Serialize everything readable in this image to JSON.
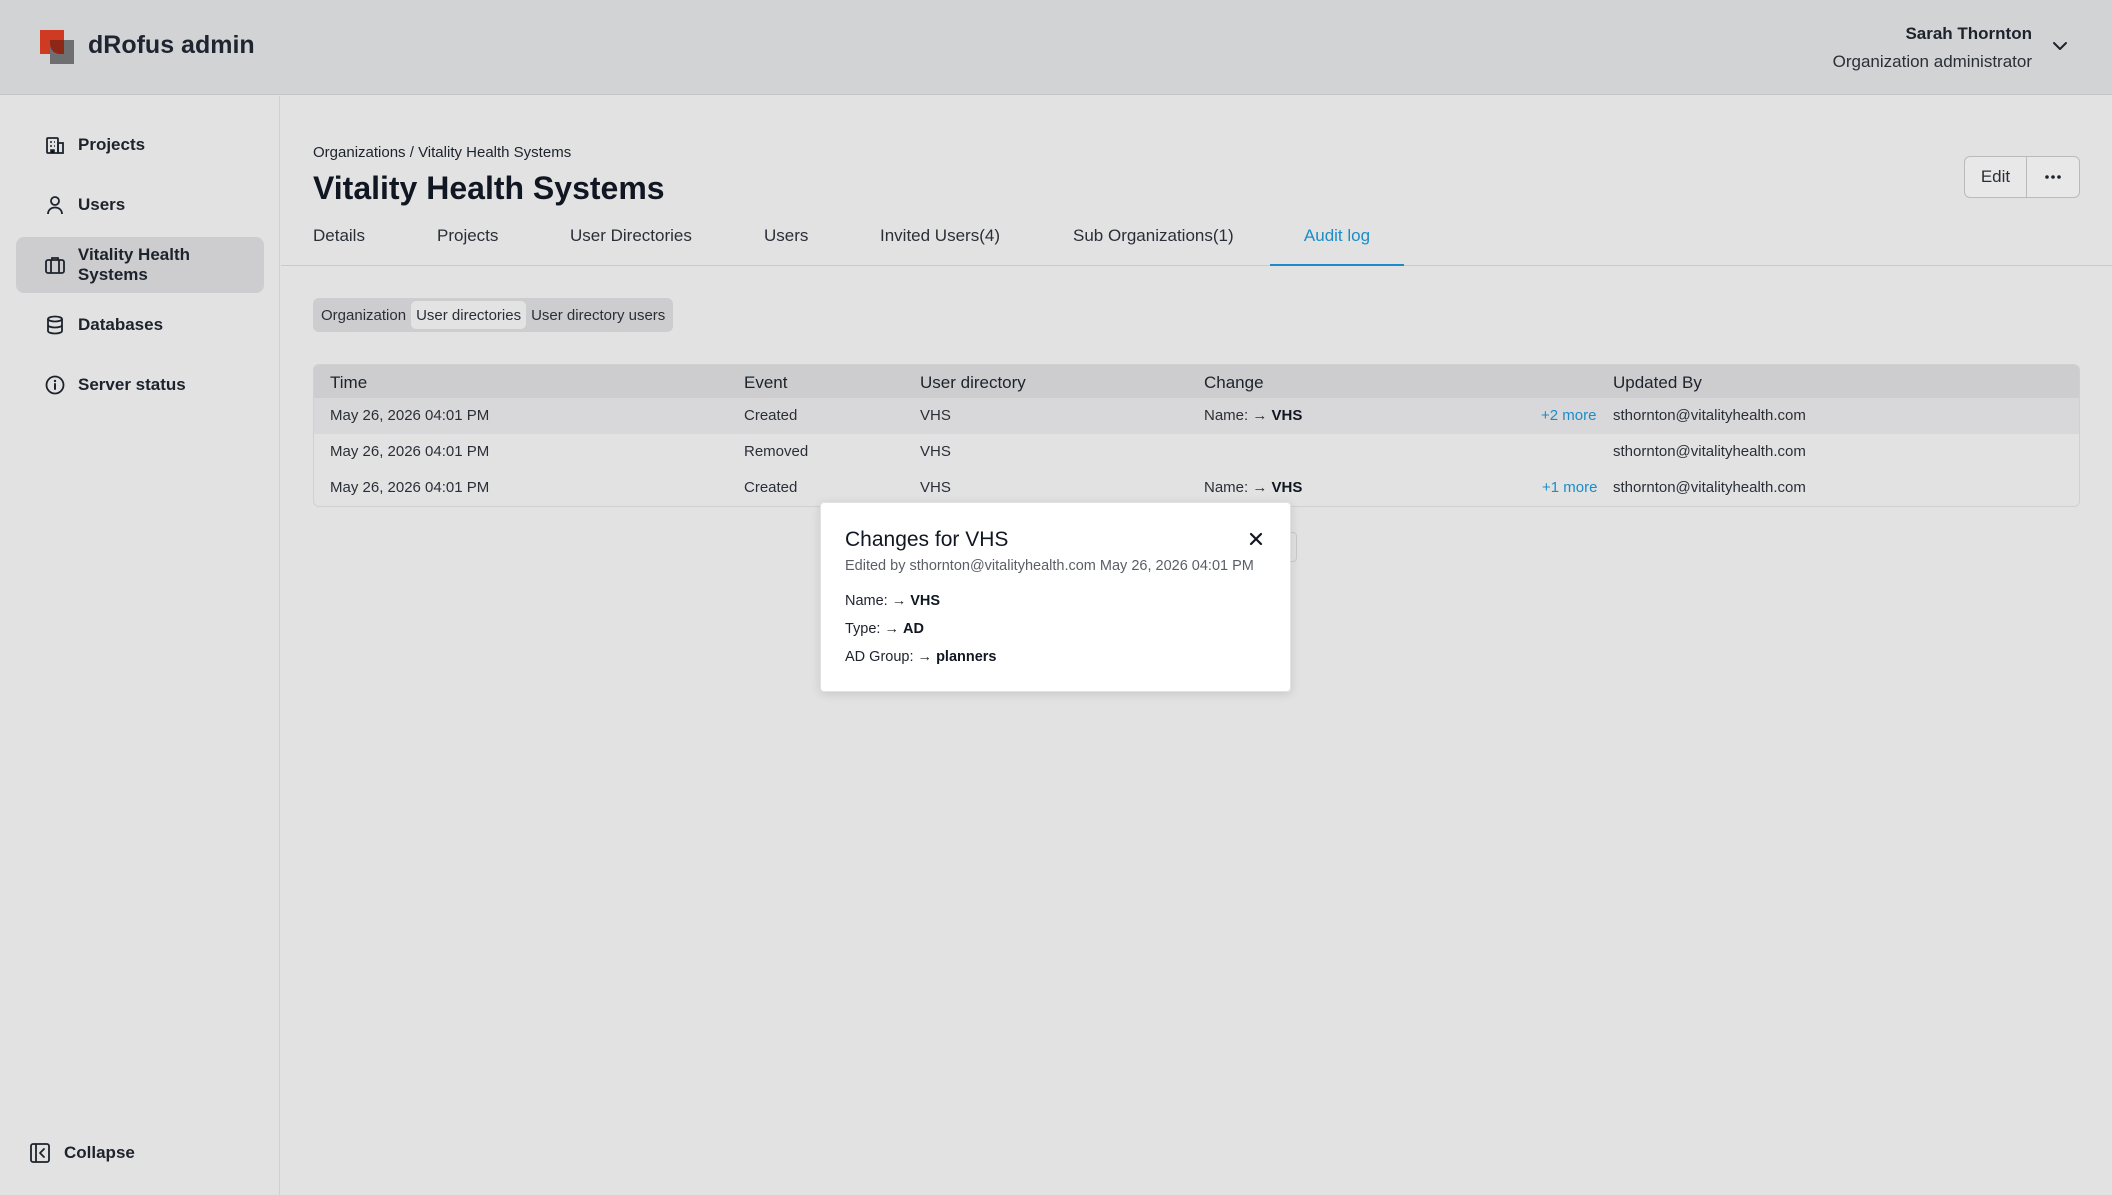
{
  "app": {
    "title": "dRofus admin"
  },
  "user": {
    "name": "Sarah Thornton",
    "role": "Organization administrator"
  },
  "sidebar": {
    "items": [
      {
        "label": "Projects",
        "icon": "building-icon"
      },
      {
        "label": "Users",
        "icon": "user-icon"
      },
      {
        "label": "Vitality Health Systems",
        "icon": "briefcase-icon",
        "active": true
      },
      {
        "label": "Databases",
        "icon": "database-icon"
      },
      {
        "label": "Server status",
        "icon": "info-icon"
      }
    ],
    "collapse_label": "Collapse"
  },
  "breadcrumb": {
    "root": "Organizations",
    "separator": " / ",
    "current": "Vitality Health Systems"
  },
  "page": {
    "title": "Vitality Health Systems",
    "edit_label": "Edit"
  },
  "tabs": [
    {
      "label": "Details"
    },
    {
      "label": "Projects"
    },
    {
      "label": "User Directories"
    },
    {
      "label": "Users"
    },
    {
      "label": "Invited Users(4)"
    },
    {
      "label": "Sub Organizations(1)"
    },
    {
      "label": "Audit log",
      "active": true
    }
  ],
  "segments": [
    {
      "label": "Organization"
    },
    {
      "label": "User directories",
      "active": true
    },
    {
      "label": "User directory users"
    }
  ],
  "table": {
    "headers": {
      "time": "Time",
      "event": "Event",
      "directory": "User directory",
      "change": "Change",
      "updated_by": "Updated By"
    },
    "rows": [
      {
        "time": "May 26, 2026 04:01 PM",
        "event": "Created",
        "directory": "VHS",
        "change_key": "Name: → ",
        "change_val": "VHS",
        "more": "+2 more",
        "updated_by": "sthornton@vitalityhealth.com"
      },
      {
        "time": "May 26, 2026 04:01 PM",
        "event": "Removed",
        "directory": "VHS",
        "change_key": "",
        "change_val": "",
        "more": "",
        "updated_by": "sthornton@vitalityhealth.com"
      },
      {
        "time": "May 26, 2026 04:01 PM",
        "event": "Created",
        "directory": "VHS",
        "change_key": "Name: → ",
        "change_val": "VHS",
        "more": "+1 more",
        "updated_by": "sthornton@vitalityhealth.com"
      }
    ]
  },
  "popover": {
    "title": "Changes for VHS",
    "subtitle": "Edited by sthornton@vitalityhealth.com May 26, 2026 04:01 PM",
    "changes": [
      {
        "key": "Name: → ",
        "value": "VHS"
      },
      {
        "key": "Type: → ",
        "value": "AD"
      },
      {
        "key": "AD Group: → ",
        "value": "planners"
      }
    ]
  },
  "colors": {
    "accent": "#1a8dc8",
    "brand": "#cf3a22"
  }
}
